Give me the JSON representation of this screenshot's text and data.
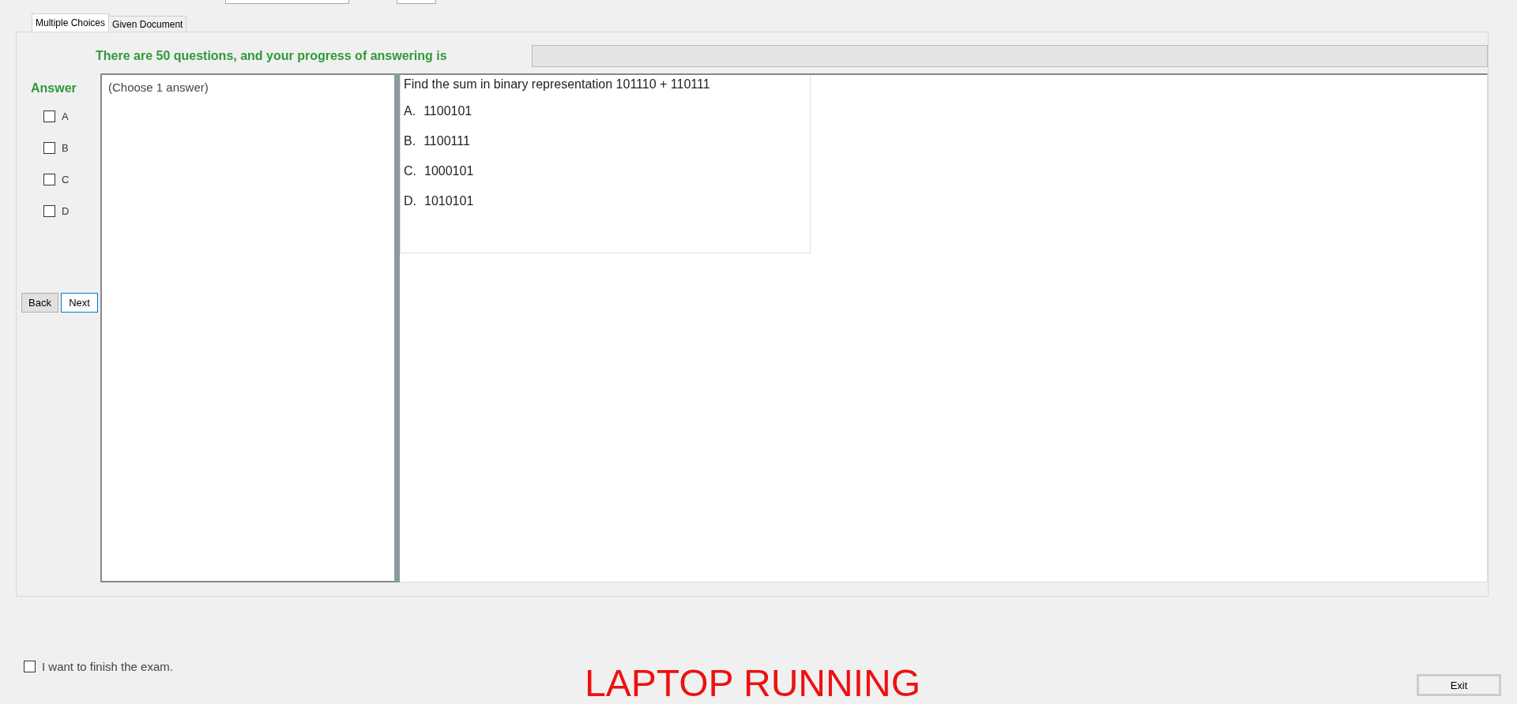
{
  "tabs": [
    {
      "label": "Multiple Choices",
      "selected": true
    },
    {
      "label": "Given Document",
      "selected": false
    }
  ],
  "progress": {
    "label": "There are 50 questions, and your progress of answering is",
    "level": 0
  },
  "answer": {
    "title": "Answer",
    "options": [
      {
        "label": "A",
        "checked": false
      },
      {
        "label": "B",
        "checked": false
      },
      {
        "label": "C",
        "checked": false
      },
      {
        "label": "D",
        "checked": false
      }
    ]
  },
  "nav_buttons": [
    {
      "label": "Back",
      "selected": false
    },
    {
      "label": "Next",
      "selected": true
    }
  ],
  "instruction": "(Choose 1 answer)",
  "question": {
    "text": "Find the sum in binary representation 101110 + 110111",
    "choices": [
      {
        "letter": "A.",
        "value": "1100101"
      },
      {
        "letter": "B.",
        "value": "1100111"
      },
      {
        "letter": "C.",
        "value": "1000101"
      },
      {
        "letter": "D.",
        "value": "1010101"
      }
    ]
  },
  "finish": {
    "label": "I want to finish the exam.",
    "checked": false
  },
  "status": "LAPTOP RUNNING",
  "exit_button": "Exit"
}
